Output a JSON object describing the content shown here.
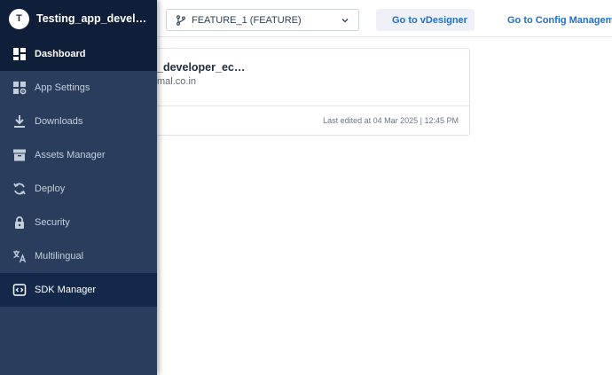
{
  "sidebar": {
    "avatar_letter": "T",
    "app_name": "Testing_app_developer_ec…",
    "items": [
      {
        "label": "Dashboard",
        "icon": "dashboard-icon"
      },
      {
        "label": "App Settings",
        "icon": "app-settings-icon"
      },
      {
        "label": "Downloads",
        "icon": "download-icon"
      },
      {
        "label": "Assets Manager",
        "icon": "archive-icon"
      },
      {
        "label": "Deploy",
        "icon": "sync-icon"
      },
      {
        "label": "Security",
        "icon": "lock-icon"
      },
      {
        "label": "Multilingual",
        "icon": "translate-icon"
      },
      {
        "label": "SDK Manager",
        "icon": "sdk-icon"
      }
    ]
  },
  "topbar": {
    "branch": "FEATURE_1 (FEATURE)",
    "vdesigner_label": "Go to vDesigner",
    "config_label": "Go to Config Manageme"
  },
  "card": {
    "title": "_developer_ec…",
    "subtitle": "mal.co.in",
    "edited": "Last edited at 04 Mar 2025 | 12:45 PM"
  },
  "colors": {
    "sidebar_bg": "#2a3d5c",
    "sidebar_header_bg": "#0f1f3a",
    "link_blue": "#1f6fd1"
  }
}
